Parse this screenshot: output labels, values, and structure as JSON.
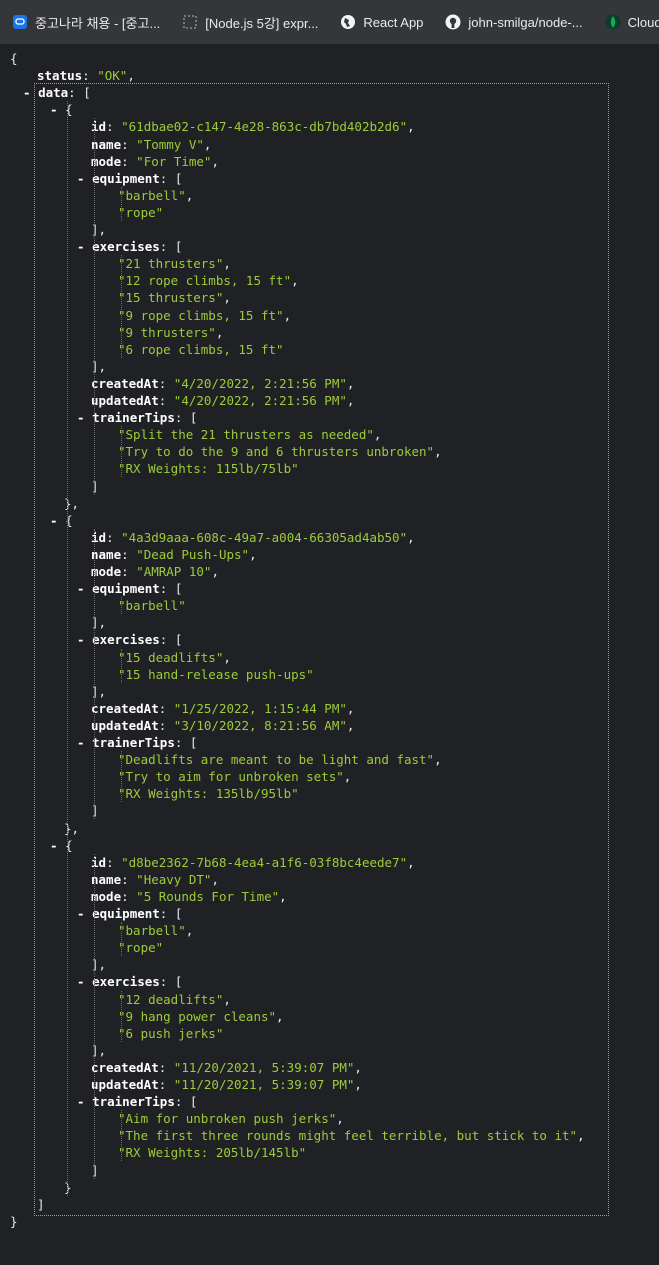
{
  "bookmarks": [
    {
      "label": "중고나라 채용 - [중고...",
      "icon": "chat-bubble-icon"
    },
    {
      "label": "[Node.js 5강] expr...",
      "icon": "node-icon"
    },
    {
      "label": "React App",
      "icon": "globe-icon"
    },
    {
      "label": "john-smilga/node-...",
      "icon": "github-icon"
    },
    {
      "label": "Cloud: Mor",
      "icon": "mongodb-leaf-icon"
    }
  ],
  "json": {
    "status": "\"OK\"",
    "data": [
      {
        "id": "\"61dbae02-c147-4e28-863c-db7bd402b2d6\"",
        "name": "\"Tommy V\"",
        "mode": "\"For Time\"",
        "equipment": [
          "\"barbell\"",
          "\"rope\""
        ],
        "exercises": [
          "\"21 thrusters\"",
          "\"12 rope climbs, 15 ft\"",
          "\"15 thrusters\"",
          "\"9 rope climbs, 15 ft\"",
          "\"9 thrusters\"",
          "\"6 rope climbs, 15 ft\""
        ],
        "createdAt": "\"4/20/2022, 2:21:56 PM\"",
        "updatedAt": "\"4/20/2022, 2:21:56 PM\"",
        "trainerTips": [
          "\"Split the 21 thrusters as needed\"",
          "\"Try to do the 9 and 6 thrusters unbroken\"",
          "\"RX Weights: 115lb/75lb\""
        ]
      },
      {
        "id": "\"4a3d9aaa-608c-49a7-a004-66305ad4ab50\"",
        "name": "\"Dead Push-Ups\"",
        "mode": "\"AMRAP 10\"",
        "equipment": [
          "\"barbell\""
        ],
        "exercises": [
          "\"15 deadlifts\"",
          "\"15 hand-release push-ups\""
        ],
        "createdAt": "\"1/25/2022, 1:15:44 PM\"",
        "updatedAt": "\"3/10/2022, 8:21:56 AM\"",
        "trainerTips": [
          "\"Deadlifts are meant to be light and fast\"",
          "\"Try to aim for unbroken sets\"",
          "\"RX Weights: 135lb/95lb\""
        ]
      },
      {
        "id": "\"d8be2362-7b68-4ea4-a1f6-03f8bc4eede7\"",
        "name": "\"Heavy DT\"",
        "mode": "\"5 Rounds For Time\"",
        "equipment": [
          "\"barbell\"",
          "\"rope\""
        ],
        "exercises": [
          "\"12 deadlifts\"",
          "\"9 hang power cleans\"",
          "\"6 push jerks\""
        ],
        "createdAt": "\"11/20/2021, 5:39:07 PM\"",
        "updatedAt": "\"11/20/2021, 5:39:07 PM\"",
        "trainerTips": [
          "\"Aim for unbroken push jerks\"",
          "\"The first three rounds might feel terrible, but stick to it\"",
          "\"RX Weights: 205lb/145lb\""
        ]
      }
    ]
  },
  "colors": {
    "string": "#9ccc3a",
    "key": "#ffffff",
    "background": "#202124"
  }
}
